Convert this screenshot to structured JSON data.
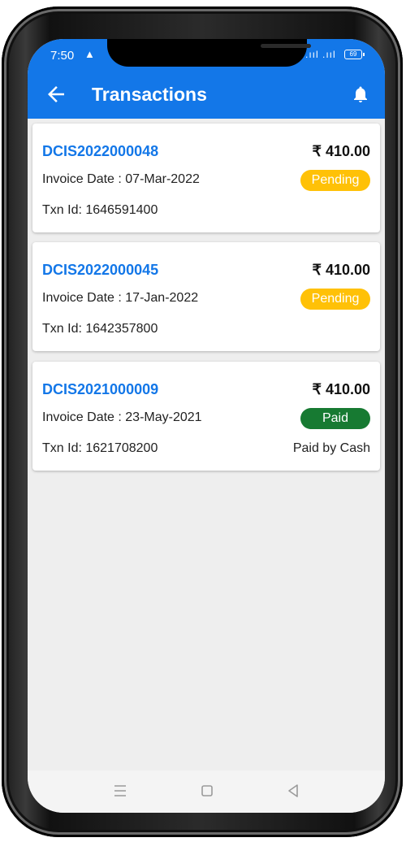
{
  "status_bar": {
    "time": "7:50",
    "battery": "69"
  },
  "app_bar": {
    "title": "Transactions"
  },
  "icons": {
    "back": "arrow-left-icon",
    "notifications": "bell-icon",
    "nav_menu": "menu-icon",
    "nav_home": "square-home-icon",
    "nav_back": "triangle-back-icon"
  },
  "colors": {
    "primary": "#1377e8",
    "pending": "#ffc107",
    "paid": "#177a32",
    "background": "#eeeeee"
  },
  "transactions": [
    {
      "invoice_no": "DCIS2022000048",
      "amount": "₹ 410.00",
      "invoice_date": "Invoice Date : 07-Mar-2022",
      "status": "Pending",
      "txn_id": "Txn Id: 1646591400",
      "payment_note": ""
    },
    {
      "invoice_no": "DCIS2022000045",
      "amount": "₹ 410.00",
      "invoice_date": "Invoice Date : 17-Jan-2022",
      "status": "Pending",
      "txn_id": "Txn Id: 1642357800",
      "payment_note": ""
    },
    {
      "invoice_no": "DCIS2021000009",
      "amount": "₹ 410.00",
      "invoice_date": "Invoice Date : 23-May-2021",
      "status": "Paid",
      "txn_id": "Txn Id: 1621708200",
      "payment_note": "Paid by Cash"
    }
  ]
}
